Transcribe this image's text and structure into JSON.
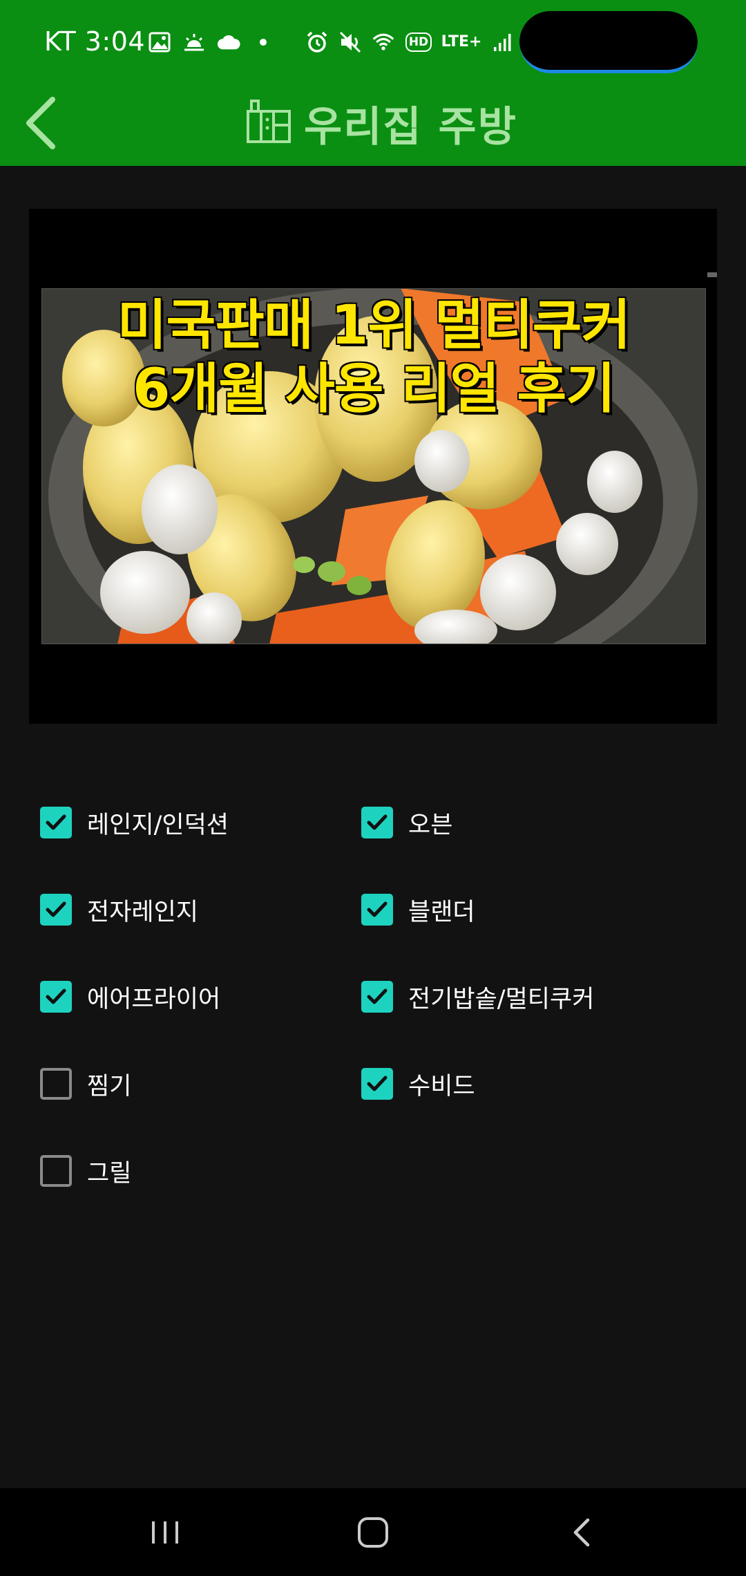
{
  "status_bar": {
    "carrier_time": "KT 3:04",
    "network_label": "LTE+",
    "hd_label": "HD",
    "icons": [
      "gallery-icon",
      "sunrise-weather-icon",
      "cloud-icon",
      "dot-icon",
      "alarm-icon",
      "mute-icon",
      "wifi-icon",
      "hd-voice-icon",
      "lte-icon",
      "signal-icon",
      "battery-icon"
    ]
  },
  "header": {
    "title": "우리집 주방",
    "icon": "kitchen-appliance-icon",
    "back_icon": "back-chevron-icon"
  },
  "video": {
    "thumbnail_line1": "미국판매 1위 멀티쿠커",
    "thumbnail_line2": "6개월 사용 리얼 후기"
  },
  "options": [
    {
      "label": "레인지/인덕션",
      "checked": true
    },
    {
      "label": "오븐",
      "checked": true
    },
    {
      "label": "전자레인지",
      "checked": true
    },
    {
      "label": "블랜더",
      "checked": true
    },
    {
      "label": "에어프라이어",
      "checked": true
    },
    {
      "label": "전기밥솥/멀티쿠커",
      "checked": true
    },
    {
      "label": "찜기",
      "checked": false
    },
    {
      "label": "수비드",
      "checked": true
    },
    {
      "label": "그릴",
      "checked": false
    }
  ],
  "colors": {
    "header_green": "#0a8f12",
    "title_green": "#a8e3a2",
    "checkbox_teal": "#1dd3c0",
    "background": "#121212"
  },
  "nav_bar": {
    "icons": [
      "recent-apps-icon",
      "home-icon",
      "back-icon"
    ]
  }
}
